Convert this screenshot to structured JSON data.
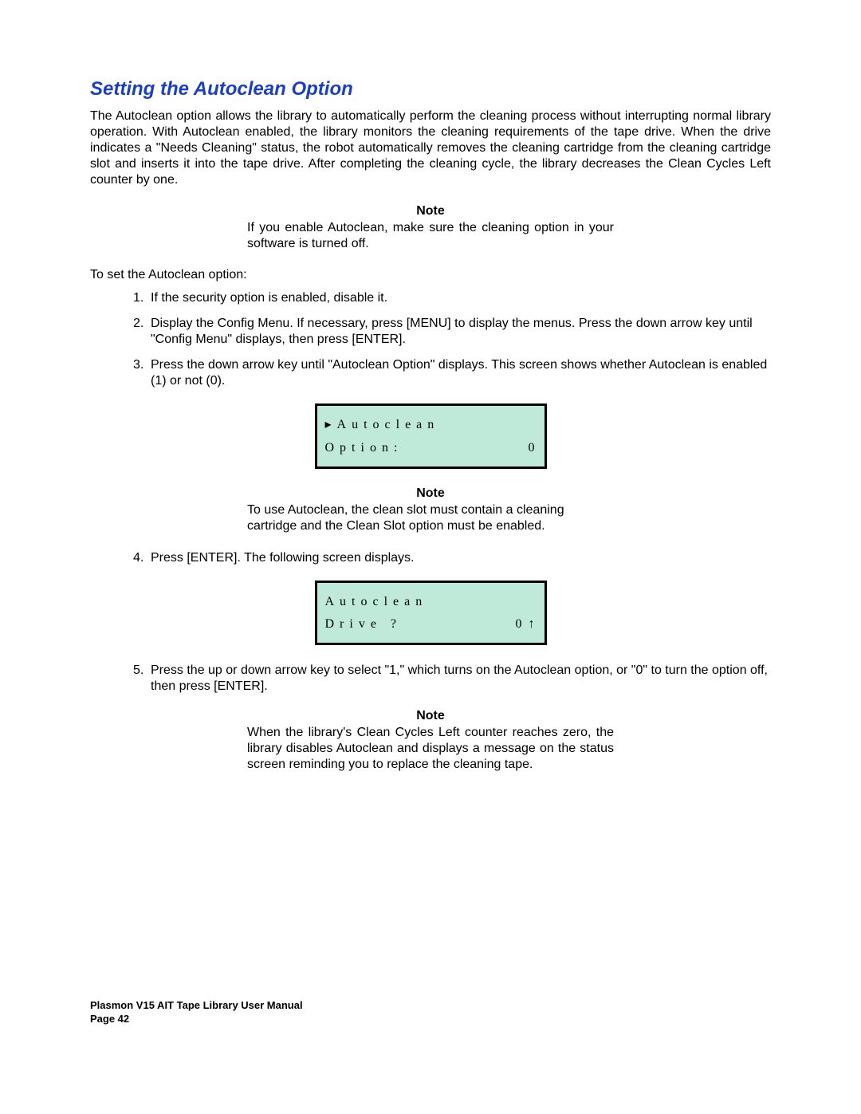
{
  "heading": "Setting the Autoclean Option",
  "intro_paragraph": "The Autoclean option allows the library to automatically perform the cleaning process without interrupting normal library operation. With Autoclean enabled, the library monitors the cleaning requirements of the tape drive. When the drive indicates a \"Needs Cleaning\" status, the robot automatically removes the cleaning cartridge from the cleaning cartridge slot and inserts it into the tape drive. After completing the cleaning cycle, the library decreases the Clean Cycles Left counter by one.",
  "note1": {
    "title": "Note",
    "body": "If you enable Autoclean, make sure the cleaning option in your software is turned off."
  },
  "intro_line": "To set the Autoclean option:",
  "steps": {
    "s1": {
      "num": "1.",
      "text": "If the security option is enabled, disable it."
    },
    "s2": {
      "num": "2.",
      "text": "Display the Config Menu. If necessary, press [MENU] to display the menus. Press the down arrow key until \"Config Menu\" displays, then press [ENTER]."
    },
    "s3": {
      "num": "3.",
      "text": "Press the down arrow key until \"Autoclean Option\" displays. This screen shows whether Autoclean is enabled (1) or not (0)."
    },
    "s4": {
      "num": "4.",
      "text": " Press [ENTER]. The following screen displays."
    },
    "s5": {
      "num": "5.",
      "text": "Press the up or down arrow key to select \"1,\" which turns on the Autoclean option, or \"0\" to turn the option off, then press [ENTER]."
    }
  },
  "lcd1": {
    "line1_left": "▸Autoclean",
    "line2_left": " Option:",
    "line2_right": "0"
  },
  "note2": {
    "title": "Note",
    "body": "To use Autoclean, the clean slot must contain a cleaning cartridge and the Clean Slot option must be enabled."
  },
  "lcd2": {
    "line1_left": "Autoclean",
    "line2_left": "Drive ?",
    "line2_right": "0 ↑"
  },
  "note3": {
    "title": "Note",
    "body": "When the library's Clean Cycles Left counter reaches zero, the library disables Autoclean and displays a message on the status screen reminding you to replace the cleaning tape."
  },
  "footer": {
    "line1_a": "Plasmon ",
    "line1_b": "V",
    "line1_c": "15 AIT Tape Library User Manual",
    "line2": "Page 42"
  }
}
